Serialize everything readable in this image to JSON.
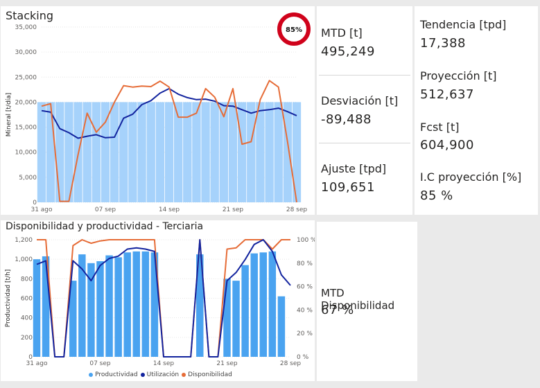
{
  "stacking": {
    "title": "Stacking",
    "badge": "85%",
    "colors": {
      "bars": "#a6d2fb",
      "line_dark": "#12239e",
      "line_orange": "#e66c37",
      "badge_ring": "#d0021b"
    },
    "chart_data": {
      "type": "line",
      "ylabel": "Mineral [t/día]",
      "ylim": [
        0,
        35000
      ],
      "yticks": [
        "0",
        "5,000",
        "10,000",
        "15,000",
        "20,000",
        "25,000",
        "30,000",
        "35,000"
      ],
      "xticks": [
        "31 ago",
        "07 sep",
        "14 sep",
        "21 sep",
        "28 sep"
      ],
      "x": [
        "31 ago",
        "01 sep",
        "02 sep",
        "03 sep",
        "04 sep",
        "05 sep",
        "06 sep",
        "07 sep",
        "08 sep",
        "09 sep",
        "10 sep",
        "11 sep",
        "12 sep",
        "13 sep",
        "14 sep",
        "15 sep",
        "16 sep",
        "17 sep",
        "18 sep",
        "19 sep",
        "20 sep",
        "21 sep",
        "22 sep",
        "23 sep",
        "24 sep",
        "25 sep",
        "26 sep",
        "27 sep",
        "28 sep"
      ],
      "series": [
        {
          "kind": "bar",
          "values": [
            20000,
            20000,
            20000,
            20000,
            20000,
            20000,
            20000,
            20000,
            20000,
            20000,
            20000,
            20000,
            20000,
            20000,
            20000,
            20000,
            20000,
            20000,
            20000,
            20000,
            20000,
            20000,
            20000,
            20000,
            20000,
            20000,
            20000,
            20000,
            20000
          ]
        },
        {
          "kind": "line",
          "color": "#12239e",
          "values": [
            18300,
            18000,
            14700,
            13900,
            12800,
            13200,
            13500,
            12900,
            13000,
            16800,
            17600,
            19500,
            20300,
            21800,
            22700,
            21600,
            20900,
            20500,
            20600,
            20200,
            19300,
            19200,
            18500,
            17800,
            18300,
            18500,
            18800,
            18100,
            17300
          ]
        },
        {
          "kind": "line",
          "color": "#e66c37",
          "values": [
            19200,
            19700,
            200,
            200,
            9500,
            17800,
            14000,
            16000,
            20000,
            23300,
            23000,
            23200,
            23100,
            24200,
            23000,
            17000,
            17000,
            17800,
            22700,
            21000,
            17100,
            22700,
            11600,
            12100,
            20500,
            24300,
            23000,
            12000,
            0
          ]
        }
      ]
    }
  },
  "kpis_mid": [
    {
      "label": "MTD [t]",
      "value": "495,249"
    },
    {
      "label": "Desviación [t]",
      "value": "-89,488"
    },
    {
      "label": "Ajuste [tpd]",
      "value": "109,651"
    }
  ],
  "kpis_right": [
    {
      "label": "Tendencia [tpd]",
      "value": "17,388"
    },
    {
      "label": "Proyección [t]",
      "value": "512,637"
    },
    {
      "label": "Fcst [t]",
      "value": "604,900"
    },
    {
      "label": "I.C proyección [%]",
      "value": "85 %"
    }
  ],
  "disponibilidad": {
    "title": "Disponibilidad y productividad - Terciaria",
    "legend": [
      "Productividad",
      "Utilización",
      "Disponibilidad"
    ],
    "colors": {
      "bars": "#4aa3f0",
      "line_dark": "#12239e",
      "line_orange": "#e66c37"
    },
    "chart_data": {
      "type": "bar",
      "ylabel": "Productividad [t/h]",
      "ylim": [
        0,
        1200
      ],
      "yticks": [
        "0",
        "200",
        "400",
        "600",
        "800",
        "1,000",
        "1,200"
      ],
      "y2ticks": [
        "0 %",
        "20 %",
        "40 %",
        "60 %",
        "80 %",
        "100 %"
      ],
      "xticks": [
        "31 ago",
        "07 sep",
        "14 sep",
        "21 sep",
        "28 sep"
      ],
      "x": [
        "31 ago",
        "01 sep",
        "02 sep",
        "03 sep",
        "04 sep",
        "05 sep",
        "06 sep",
        "07 sep",
        "08 sep",
        "09 sep",
        "10 sep",
        "11 sep",
        "12 sep",
        "13 sep",
        "14 sep",
        "15 sep",
        "16 sep",
        "17 sep",
        "18 sep",
        "19 sep",
        "20 sep",
        "21 sep",
        "22 sep",
        "23 sep",
        "24 sep",
        "25 sep",
        "26 sep",
        "27 sep",
        "28 sep"
      ],
      "series": [
        {
          "name": "Productividad",
          "kind": "bar",
          "values": [
            1000,
            1030,
            0,
            0,
            780,
            1050,
            960,
            980,
            1040,
            1020,
            1070,
            1080,
            1080,
            1070,
            0,
            0,
            0,
            0,
            1050,
            0,
            0,
            800,
            780,
            940,
            1060,
            1070,
            1080,
            620,
            0
          ]
        },
        {
          "name": "Utilización",
          "kind": "line",
          "unit": "%",
          "values": [
            79,
            82,
            0,
            0,
            82,
            75,
            65,
            78,
            84,
            86,
            92,
            93,
            92,
            90,
            0,
            0,
            0,
            0,
            100,
            0,
            0,
            65,
            72,
            83,
            96,
            100,
            90,
            70,
            61
          ]
        },
        {
          "name": "Disponibilidad",
          "kind": "line",
          "unit": "%",
          "values": [
            100,
            100,
            0,
            0,
            95,
            100,
            97,
            99,
            100,
            100,
            100,
            100,
            100,
            100,
            0,
            0,
            0,
            0,
            100,
            0,
            0,
            92,
            93,
            100,
            100,
            100,
            92,
            100,
            100
          ]
        }
      ]
    }
  },
  "mtd_disp": {
    "label": "MTD Disponibilidad",
    "value": "67 %"
  }
}
